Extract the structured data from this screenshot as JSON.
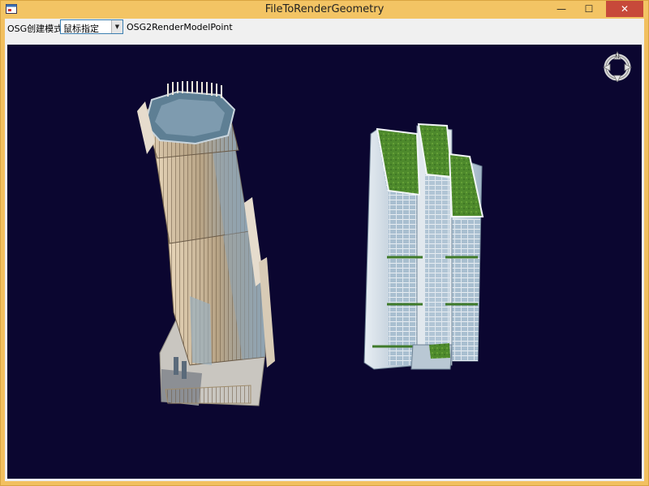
{
  "window": {
    "title": "FileToRenderGeometry",
    "buttons": {
      "minimize": "—",
      "maximize": "☐",
      "close": "✕"
    }
  },
  "toolbar": {
    "mode_label": "OSG创建模式：",
    "mode_value": "鼠标指定",
    "render_label": "OSG2RenderModelPoint"
  },
  "viewport": {
    "background": "#0b0630",
    "compass_letter": "N",
    "objects": [
      "tower-octagonal",
      "tower-green-roof"
    ]
  },
  "colors": {
    "titlebar": "#f3c464",
    "close": "#c7493a",
    "facade_glass": "#9fb8c8",
    "roof_green": "#4e8a2c"
  },
  "icons": [
    "app-icon",
    "compass-icon",
    "chevron-down-icon"
  ]
}
